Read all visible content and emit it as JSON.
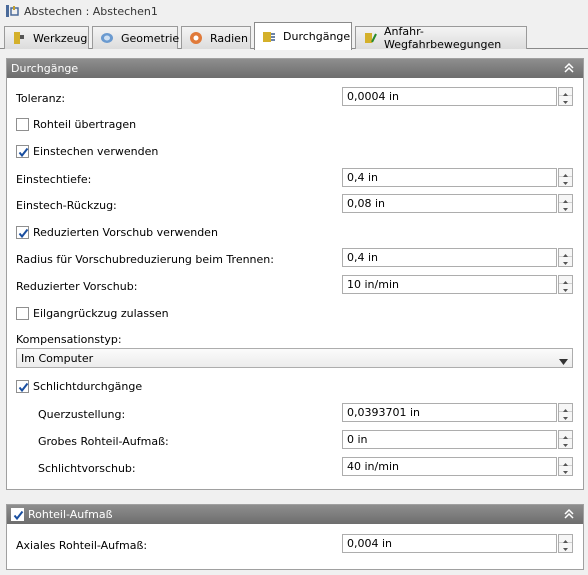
{
  "window": {
    "title": "Abstechen : Abstechen1",
    "title_icon": "operation-icon"
  },
  "tabs": [
    {
      "label": "Werkzeug",
      "icon": "tool-icon"
    },
    {
      "label": "Geometrie",
      "icon": "geometry-icon"
    },
    {
      "label": "Radien",
      "icon": "radius-icon"
    },
    {
      "label": "Durchgänge",
      "icon": "passes-icon",
      "active": true
    },
    {
      "label": "Anfahr-Wegfahrbewegungen",
      "icon": "linking-icon"
    }
  ],
  "passes": {
    "header": "Durchgänge",
    "tolerance": {
      "label": "Toleranz:",
      "value": "0,0004 in"
    },
    "stock_transfer": {
      "label": "Rohteil übertragen",
      "checked": false
    },
    "use_grooving": {
      "label": "Einstechen verwenden",
      "checked": true
    },
    "groove_depth": {
      "label": "Einstechtiefe:",
      "value": "0,4 in"
    },
    "groove_retract": {
      "label": "Einstech-Rückzug:",
      "value": "0,08 in"
    },
    "reduced_feed": {
      "label": "Reduzierten Vorschub verwenden",
      "checked": true
    },
    "reduction_radius": {
      "label": "Radius für Vorschubreduzierung beim Trennen:",
      "value": "0,4 in"
    },
    "reduced_feedrate": {
      "label": "Reduzierter Vorschub:",
      "value": "10 in/min"
    },
    "rapid_retract": {
      "label": "Eilgangrückzug zulassen",
      "checked": false
    },
    "compensation": {
      "label": "Kompensationstyp:",
      "value": "Im Computer"
    },
    "finishing": {
      "label": "Schlichtdurchgänge",
      "checked": true
    },
    "stepover": {
      "label": "Querzustellung:",
      "value": "0,0393701 in"
    },
    "rough_stock": {
      "label": "Grobes Rohteil-Aufmaß:",
      "value": "0 in"
    },
    "finish_feed": {
      "label": "Schlichtvorschub:",
      "value": "40 in/min"
    }
  },
  "stock_section": {
    "header": "Rohteil-Aufmaß",
    "checked": true,
    "axial": {
      "label": "Axiales Rohteil-Aufmaß:",
      "value": "0,004 in"
    }
  },
  "colors": {
    "section_header": "#7a7a7a",
    "check": "#1a4fa0"
  }
}
